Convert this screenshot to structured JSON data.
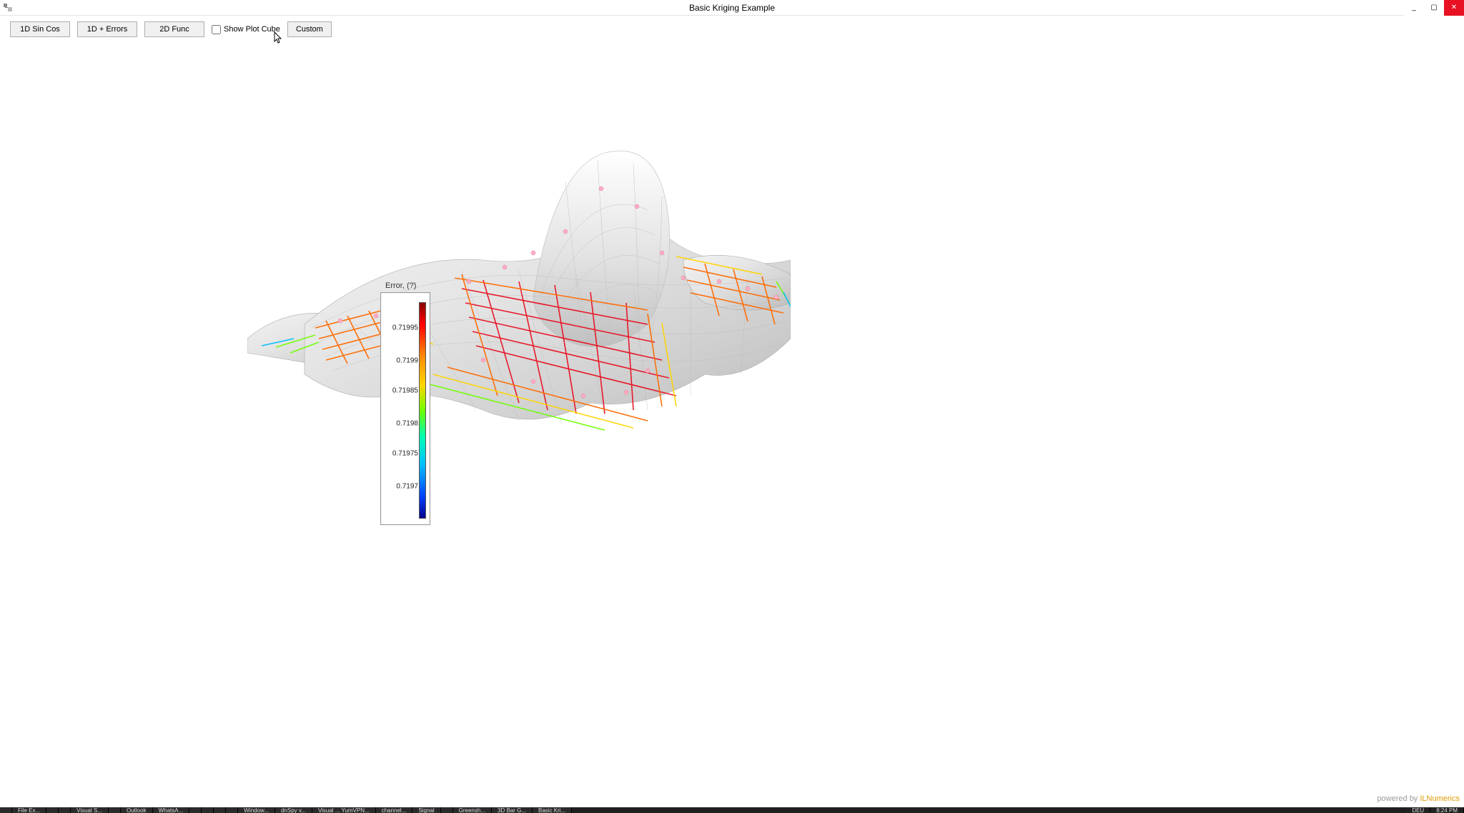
{
  "window": {
    "title": "Basic Kriging Example",
    "minimize_label": "_",
    "maximize_label": "▢",
    "close_label": "✕"
  },
  "toolbar": {
    "btn_1d_sincos": "1D Sin Cos",
    "btn_1d_errors": "1D + Errors",
    "btn_2d_func": "2D Func",
    "show_plot_cube_label": "Show Plot Cube",
    "btn_custom": "Custom"
  },
  "colorbar": {
    "title": "Error, (?)",
    "ticks": [
      {
        "value": "0.71995",
        "pos_pct": 12
      },
      {
        "value": "0.7199",
        "pos_pct": 27
      },
      {
        "value": "0.71985",
        "pos_pct": 41
      },
      {
        "value": "0.7198",
        "pos_pct": 56
      },
      {
        "value": "0.71975",
        "pos_pct": 70
      },
      {
        "value": "0.7197",
        "pos_pct": 85
      }
    ],
    "gradient_stops": [
      {
        "color": "#8b0000",
        "pct": 0
      },
      {
        "color": "#ff0000",
        "pct": 10
      },
      {
        "color": "#ff8c00",
        "pct": 25
      },
      {
        "color": "#ffd400",
        "pct": 38
      },
      {
        "color": "#6fff00",
        "pct": 50
      },
      {
        "color": "#00ffb0",
        "pct": 62
      },
      {
        "color": "#00c0ff",
        "pct": 75
      },
      {
        "color": "#0040ff",
        "pct": 90
      },
      {
        "color": "#00008b",
        "pct": 100
      }
    ]
  },
  "watermark": {
    "prefix": "powered by ",
    "brand": "ILNumerics"
  },
  "chart_data": {
    "type": "surface",
    "description": "3D kriging interpolation surface with colored wireframe overlay indicating interpolation error magnitude and pink scatter points at sample locations.",
    "peak_region": "single prominent Gaussian-like hump right-of-center",
    "error_range": [
      0.7197,
      0.71995
    ],
    "error_label": "Error, (?)",
    "colormap": "jet-like (dark red → red → orange → yellow → green → cyan → blue → dark blue)"
  },
  "taskbar": {
    "items": [
      "",
      "File Ex...",
      "",
      "",
      "Visual S...",
      "",
      "Outlook",
      "WhatsA...",
      "",
      "",
      "",
      "",
      "Window...",
      "dnSpy v...",
      "Visual ... YumVPN...",
      "channel...",
      "Signal",
      "",
      "Greensh...",
      "3D Bar G...",
      "Basic Kri..."
    ],
    "right": [
      "DEU",
      "8:24 PM"
    ]
  }
}
